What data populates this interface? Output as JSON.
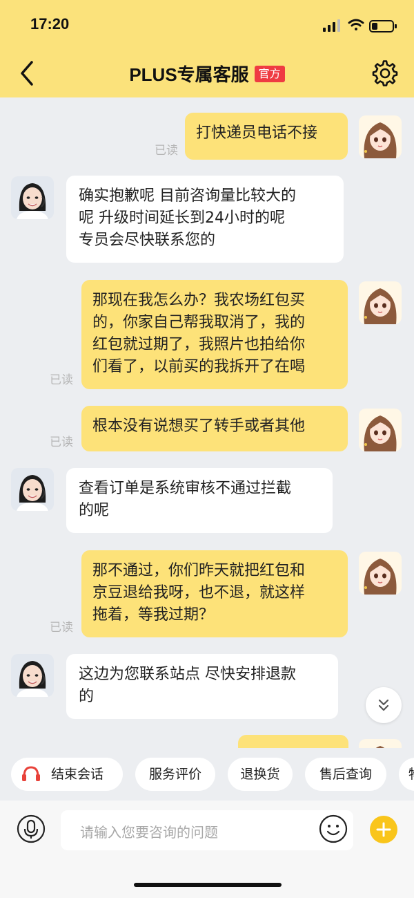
{
  "status": {
    "time": "17:20"
  },
  "header": {
    "title": "PLUS专属客服",
    "badge": "官方"
  },
  "messages": [
    {
      "from": "user",
      "lines": [
        "打快递员电话不接"
      ],
      "read": "已读"
    },
    {
      "from": "agent",
      "lines": [
        "确实抱歉呢  目前咨询量比较大的",
        "呢  升级时间延长到24小时的呢",
        "专员会尽快联系您的"
      ]
    },
    {
      "from": "user",
      "lines": [
        "那现在我怎么办？我农场红包买",
        "的，你家自己帮我取消了，我的",
        "红包就过期了，我照片也拍给你",
        "们看了，以前买的我拆开了在喝"
      ],
      "read": "已读"
    },
    {
      "from": "user",
      "lines": [
        "根本没有说想买了转手或者其他"
      ],
      "read": "已读"
    },
    {
      "from": "agent",
      "lines": [
        "查看订单是系统审核不通过拦截",
        "的呢"
      ]
    },
    {
      "from": "user",
      "lines": [
        "那不通过，你们昨天就把红包和",
        "京豆退给我呀，也不退，就这样",
        "拖着，等我过期？"
      ],
      "read": "已读"
    },
    {
      "from": "agent",
      "lines": [
        "这边为您联系站点 尽快安排退款",
        "的"
      ]
    }
  ],
  "quick_actions": [
    "结束会话",
    "服务评价",
    "退换货",
    "售后查询",
    "物"
  ],
  "input": {
    "placeholder": "请输入您要咨询的问题"
  },
  "colors": {
    "header_bg": "#fbe27b",
    "user_bubble": "#fde279",
    "accent": "#f9c51b",
    "badge": "#ef3b42"
  }
}
